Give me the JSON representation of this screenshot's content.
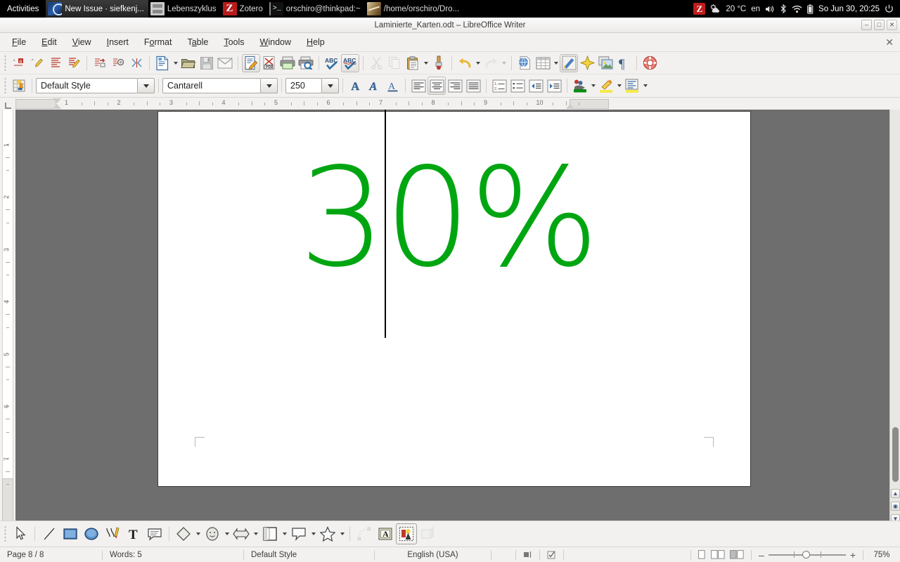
{
  "desktop": {
    "activities_label": "Activities",
    "tasks": [
      {
        "label": "New Issue · siefkenj...",
        "icon": "firefox-icon",
        "active": true
      },
      {
        "label": "Lebenszyklus",
        "icon": "files-icon",
        "active": false
      },
      {
        "label": "Zotero",
        "icon": "zotero-icon",
        "active": false
      },
      {
        "label": "orschiro@thinkpad:~",
        "icon": "terminal-icon",
        "active": false
      },
      {
        "label": "/home/orschiro/Dro...",
        "icon": "image-viewer-icon",
        "active": false
      }
    ],
    "tray": {
      "zotero_icon": "zotero-tray-icon",
      "weather_icon": "weather-cloud-sun-icon",
      "temperature": "20 °C",
      "keyboard_layout": "en",
      "volume_icon": "volume-icon",
      "bluetooth_icon": "bluetooth-icon",
      "wifi_icon": "wifi-icon",
      "battery_icon": "battery-icon",
      "clock": "So Jun 30, 20:25",
      "power_icon": "power-icon"
    }
  },
  "window": {
    "title": "Laminierte_Karten.odt – LibreOffice Writer",
    "buttons": {
      "minimize": "–",
      "maximize": "□",
      "close": "✕"
    }
  },
  "menubar": {
    "items": [
      {
        "pre": "",
        "acc": "F",
        "post": "ile"
      },
      {
        "pre": "",
        "acc": "E",
        "post": "dit"
      },
      {
        "pre": "",
        "acc": "V",
        "post": "iew"
      },
      {
        "pre": "",
        "acc": "I",
        "post": "nsert"
      },
      {
        "pre": "F",
        "acc": "o",
        "post": "rmat"
      },
      {
        "pre": "T",
        "acc": "a",
        "post": "ble"
      },
      {
        "pre": "",
        "acc": "T",
        "post": "ools"
      },
      {
        "pre": "",
        "acc": "W",
        "post": "indow"
      },
      {
        "pre": "",
        "acc": "H",
        "post": "elp"
      }
    ],
    "close_doc": "✕"
  },
  "standard_toolbar": {
    "items": [
      {
        "name": "track-changes-record-icon",
        "kind": "icon"
      },
      {
        "name": "track-changes-edit-icon",
        "kind": "icon"
      },
      {
        "name": "track-changes-show-icon",
        "kind": "icon"
      },
      {
        "name": "track-changes-manage-icon",
        "kind": "icon"
      },
      {
        "name": "separator",
        "kind": "sep"
      },
      {
        "name": "track-changes-accept-icon",
        "kind": "icon"
      },
      {
        "name": "track-changes-settings-icon",
        "kind": "icon"
      },
      {
        "name": "track-changes-compare-icon",
        "kind": "icon"
      },
      {
        "name": "separator",
        "kind": "sep"
      },
      {
        "name": "new-document-icon",
        "kind": "icon"
      },
      {
        "name": "new-document-dropdown",
        "kind": "caret"
      },
      {
        "name": "open-file-icon",
        "kind": "icon"
      },
      {
        "name": "save-icon",
        "kind": "icon"
      },
      {
        "name": "email-document-icon",
        "kind": "icon"
      },
      {
        "name": "separator",
        "kind": "sep"
      },
      {
        "name": "edit-mode-icon",
        "kind": "icon",
        "active": true
      },
      {
        "name": "export-pdf-icon",
        "kind": "icon"
      },
      {
        "name": "print-icon",
        "kind": "icon"
      },
      {
        "name": "print-preview-icon",
        "kind": "icon"
      },
      {
        "name": "separator",
        "kind": "sep"
      },
      {
        "name": "spelling-autocheck-icon",
        "kind": "icon"
      },
      {
        "name": "spelling-check-icon",
        "kind": "icon",
        "active": true
      },
      {
        "name": "separator",
        "kind": "sep"
      },
      {
        "name": "cut-icon",
        "kind": "icon",
        "disabled": true
      },
      {
        "name": "copy-icon",
        "kind": "icon",
        "disabled": true
      },
      {
        "name": "paste-icon",
        "kind": "icon"
      },
      {
        "name": "paste-dropdown",
        "kind": "caret"
      },
      {
        "name": "clone-formatting-icon",
        "kind": "icon"
      },
      {
        "name": "separator",
        "kind": "sep"
      },
      {
        "name": "undo-icon",
        "kind": "icon"
      },
      {
        "name": "undo-dropdown",
        "kind": "caret"
      },
      {
        "name": "redo-icon",
        "kind": "icon",
        "disabled": true
      },
      {
        "name": "redo-dropdown",
        "kind": "caret",
        "disabled": true
      },
      {
        "name": "separator",
        "kind": "sep"
      },
      {
        "name": "insert-hyperlink-icon",
        "kind": "icon"
      },
      {
        "name": "insert-table-icon",
        "kind": "icon"
      },
      {
        "name": "insert-table-dropdown",
        "kind": "caret"
      },
      {
        "name": "show-draw-functions-icon",
        "kind": "icon",
        "active": true
      },
      {
        "name": "insert-special-character-icon",
        "kind": "icon"
      },
      {
        "name": "insert-image-icon",
        "kind": "icon"
      },
      {
        "name": "formatting-marks-icon",
        "kind": "icon"
      },
      {
        "name": "separator",
        "kind": "sep"
      },
      {
        "name": "help-icon",
        "kind": "icon"
      }
    ]
  },
  "format_toolbar": {
    "paragraph_style_button": "paragraph-style-icon",
    "style_value": "Default Style",
    "font_value": "Cantarell",
    "size_value": "250",
    "buttons": [
      {
        "name": "bold-icon"
      },
      {
        "name": "italic-icon"
      },
      {
        "name": "underline-icon"
      },
      {
        "name": "separator",
        "kind": "sep"
      },
      {
        "name": "align-left-icon"
      },
      {
        "name": "align-center-icon",
        "active": true
      },
      {
        "name": "align-right-icon"
      },
      {
        "name": "align-justified-icon"
      },
      {
        "name": "separator",
        "kind": "sep"
      },
      {
        "name": "ordered-list-icon"
      },
      {
        "name": "unordered-list-icon"
      },
      {
        "name": "decrease-indent-icon"
      },
      {
        "name": "increase-indent-icon"
      },
      {
        "name": "separator",
        "kind": "sep"
      },
      {
        "name": "font-color-icon"
      },
      {
        "name": "font-color-dropdown",
        "kind": "caret"
      },
      {
        "name": "highlighting-color-icon"
      },
      {
        "name": "highlighting-color-dropdown",
        "kind": "caret"
      },
      {
        "name": "paragraph-background-icon"
      },
      {
        "name": "paragraph-background-dropdown",
        "kind": "caret"
      }
    ]
  },
  "rulers": {
    "horizontal_ticks": [
      "1",
      "2",
      "3",
      "4",
      "5",
      "6",
      "7",
      "8",
      "9",
      "10"
    ],
    "vertical_ticks": [
      "1",
      "2",
      "3",
      "4",
      "5",
      "6",
      "7"
    ]
  },
  "document": {
    "text": "30%",
    "text_color": "#00a611",
    "caret_visible": true
  },
  "drawing_toolbar": {
    "items": [
      {
        "name": "select-tool-icon"
      },
      {
        "name": "separator",
        "kind": "sep"
      },
      {
        "name": "line-tool-icon"
      },
      {
        "name": "rectangle-tool-icon"
      },
      {
        "name": "ellipse-tool-icon"
      },
      {
        "name": "freeform-line-tool-icon"
      },
      {
        "name": "text-box-tool-icon"
      },
      {
        "name": "callouts-tool-icon"
      },
      {
        "name": "separator",
        "kind": "sep"
      },
      {
        "name": "basic-shapes-icon"
      },
      {
        "name": "basic-shapes-dropdown",
        "kind": "caret"
      },
      {
        "name": "symbol-shapes-icon"
      },
      {
        "name": "symbol-shapes-dropdown",
        "kind": "caret"
      },
      {
        "name": "block-arrows-icon"
      },
      {
        "name": "block-arrows-dropdown",
        "kind": "caret"
      },
      {
        "name": "flowchart-shapes-icon"
      },
      {
        "name": "flowchart-dropdown",
        "kind": "caret"
      },
      {
        "name": "callout-shapes-icon"
      },
      {
        "name": "callout-shapes-dropdown",
        "kind": "caret"
      },
      {
        "name": "stars-shapes-icon"
      },
      {
        "name": "stars-dropdown",
        "kind": "caret"
      },
      {
        "name": "separator",
        "kind": "sep"
      },
      {
        "name": "points-edit-icon",
        "disabled": true
      },
      {
        "name": "fontwork-gallery-icon"
      },
      {
        "name": "from-file-image-icon",
        "selected": true
      },
      {
        "name": "extrusion-toggle-icon",
        "disabled": true
      }
    ]
  },
  "statusbar": {
    "page": "Page 8 / 8",
    "words": "Words: 5",
    "style": "Default Style",
    "language": "English (USA)",
    "selection_mode_icon": "selection-mode-icon",
    "save_state_icon": "document-modified-icon",
    "view_single_icon": "single-page-view-icon",
    "view_multi_icon": "multi-page-view-icon",
    "view_book_icon": "book-view-icon",
    "zoom_out": "–",
    "zoom_in": "+",
    "zoom_value": "75%"
  }
}
